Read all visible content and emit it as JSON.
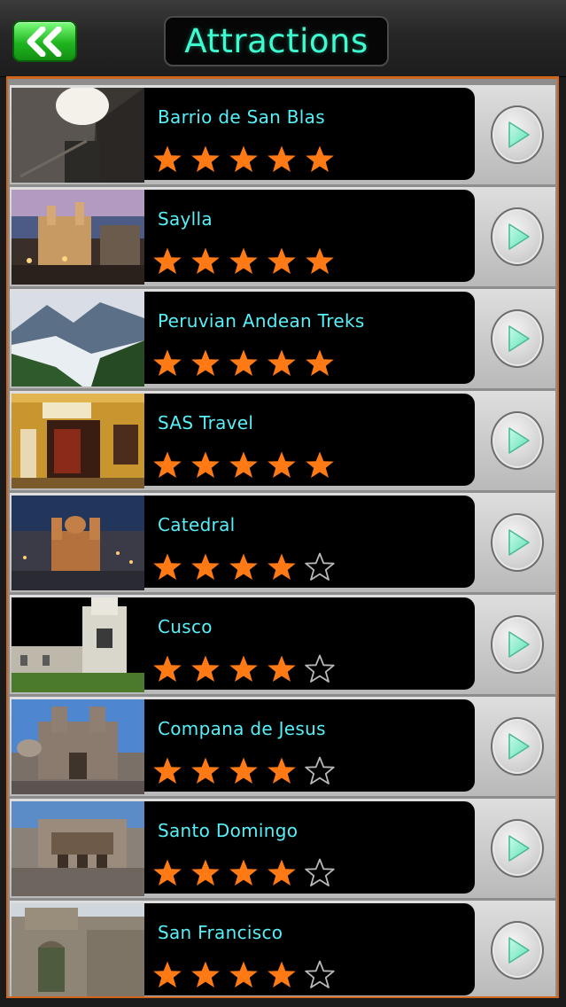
{
  "header": {
    "title": "Attractions",
    "back_icon": "double-chevron-left-icon",
    "back_color": "#2ec82e",
    "title_color": "#3dfcd0"
  },
  "list": {
    "accent": "#d0651c",
    "name_color": "#57f0f7",
    "star_color": "#ff7a14",
    "items": [
      {
        "name": "Barrio de San Blas",
        "rating": 5,
        "max": 5,
        "thumb": "narrow-stone-alley"
      },
      {
        "name": "Saylla",
        "rating": 5,
        "max": 5,
        "thumb": "cathedral-at-dusk"
      },
      {
        "name": "Peruvian Andean Treks",
        "rating": 5,
        "max": 5,
        "thumb": "mountain-valley"
      },
      {
        "name": "SAS Travel",
        "rating": 5,
        "max": 5,
        "thumb": "shop-front"
      },
      {
        "name": "Catedral",
        "rating": 4,
        "max": 5,
        "thumb": "cathedral-city-night"
      },
      {
        "name": "Cusco",
        "rating": 4,
        "max": 5,
        "thumb": "church-tower-night"
      },
      {
        "name": "Compana de Jesus",
        "rating": 4,
        "max": 5,
        "thumb": "baroque-church-day"
      },
      {
        "name": "Santo Domingo",
        "rating": 4,
        "max": 5,
        "thumb": "stone-convent"
      },
      {
        "name": "San Francisco",
        "rating": 4,
        "max": 5,
        "thumb": "stone-church-facade"
      }
    ]
  }
}
